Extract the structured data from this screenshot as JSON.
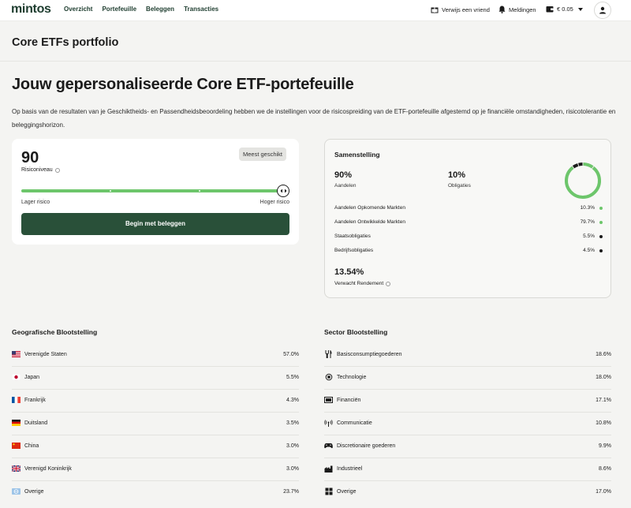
{
  "nav": {
    "logo": "mintos",
    "links": [
      "Overzicht",
      "Portefeuille",
      "Beleggen",
      "Transacties"
    ],
    "refer": "Verwijs een vriend",
    "notifications": "Meldingen",
    "balance": "€ 0.05"
  },
  "page": {
    "title": "Core ETFs portfolio",
    "heading": "Jouw gepersonaliseerde Core ETF-portefeuille",
    "description": "Op basis van de resultaten van je Geschiktheids- en Passendheidsbeoordeling hebben we de instellingen voor de risicospreiding van de ETF-portefeuille afgestemd op je financiële omstandigheden, risicotolerantie en beleggingshorizon."
  },
  "risk": {
    "value": "90",
    "label": "Risiconiveau",
    "badge": "Meest geschikt",
    "low_label": "Lager risico",
    "high_label": "Hoger risico",
    "level_fraction": 1.0,
    "cta": "Begin met beleggen"
  },
  "composition": {
    "title": "Samenstelling",
    "equity_pct": "90%",
    "equity_label": "Aandelen",
    "bonds_pct": "10%",
    "bonds_label": "Obligaties",
    "donut": [
      {
        "name": "Aandelen Opkomende Markten",
        "value": 10.3,
        "color": "#6dc66b"
      },
      {
        "name": "Aandelen Ontwikkelde Markten",
        "value": 79.7,
        "color": "#6dc66b"
      },
      {
        "name": "Staatsobligaties",
        "value": 5.5,
        "color": "#1b1b1b"
      },
      {
        "name": "Bedrijfsobligaties",
        "value": 4.5,
        "color": "#1b1b1b"
      }
    ],
    "rows": [
      {
        "name": "Aandelen Opkomende Markten",
        "value": "10.3%",
        "color": "#6dc66b"
      },
      {
        "name": "Aandelen Ontwikkelde Markten",
        "value": "79.7%",
        "color": "#6dc66b"
      },
      {
        "name": "Staatsobligaties",
        "value": "5.5%",
        "color": "#1b1b1b"
      },
      {
        "name": "Bedrijfsobligaties",
        "value": "4.5%",
        "color": "#1b1b1b"
      }
    ],
    "expected_return": "13.54%",
    "expected_return_label": "Verwacht Rendement"
  },
  "geo": {
    "title": "Geografische Blootstelling",
    "rows": [
      {
        "name": "Verenigde Staten",
        "value": "57.0%",
        "icon": "us-flag-icon"
      },
      {
        "name": "Japan",
        "value": "5.5%",
        "icon": "japan-flag-icon"
      },
      {
        "name": "Frankrijk",
        "value": "4.3%",
        "icon": "france-flag-icon"
      },
      {
        "name": "Duitsland",
        "value": "3.5%",
        "icon": "germany-flag-icon"
      },
      {
        "name": "China",
        "value": "3.0%",
        "icon": "china-flag-icon"
      },
      {
        "name": "Verenigd Koninkrijk",
        "value": "3.0%",
        "icon": "uk-flag-icon"
      },
      {
        "name": "Overige",
        "value": "23.7%",
        "icon": "globe-icon"
      }
    ]
  },
  "sector": {
    "title": "Sector Blootstelling",
    "rows": [
      {
        "name": "Basisconsumptiegoederen",
        "value": "18.6%",
        "icon": "cutlery-icon"
      },
      {
        "name": "Technologie",
        "value": "18.0%",
        "icon": "chip-icon"
      },
      {
        "name": "Financiën",
        "value": "17.1%",
        "icon": "banknote-icon"
      },
      {
        "name": "Communicatie",
        "value": "10.8%",
        "icon": "antenna-icon"
      },
      {
        "name": "Discretionaire goederen",
        "value": "9.9%",
        "icon": "gamepad-icon"
      },
      {
        "name": "Industrieel",
        "value": "8.6%",
        "icon": "factory-icon"
      },
      {
        "name": "Overige",
        "value": "17.0%",
        "icon": "grid-icon"
      }
    ]
  }
}
